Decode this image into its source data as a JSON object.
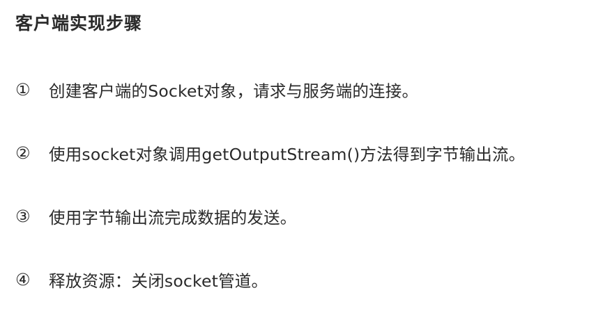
{
  "title": "客户端实现步骤",
  "steps": [
    {
      "number": "①",
      "text": "创建客户端的Socket对象，请求与服务端的连接。"
    },
    {
      "number": "②",
      "text": "使用socket对象调用getOutputStream()方法得到字节输出流。"
    },
    {
      "number": "③",
      "text": "使用字节输出流完成数据的发送。"
    },
    {
      "number": "④",
      "text": "释放资源：关闭socket管道。"
    }
  ]
}
